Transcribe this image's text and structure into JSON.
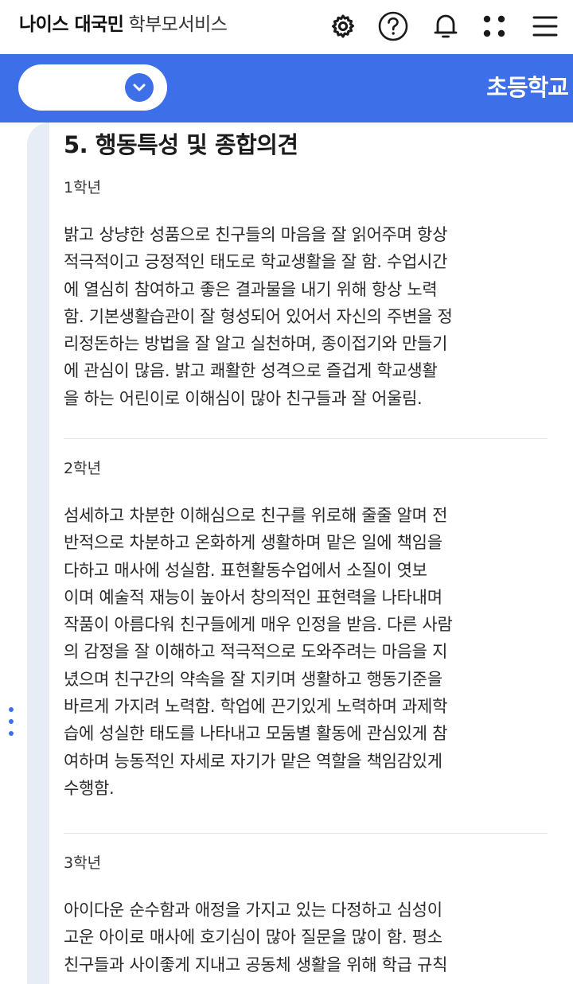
{
  "header": {
    "brand_bold": "나이스 대국민",
    "brand_light": "학부모서비스",
    "icons": [
      "gear-icon",
      "help-icon",
      "bell-icon",
      "apps-icon",
      "menu-icon"
    ]
  },
  "filter": {
    "selected_value": "",
    "school_label": "초등학교"
  },
  "colors": {
    "accent": "#3d6fe8",
    "gutter": "#e6edf5"
  },
  "section": {
    "title": "5. 행동특성 및 종합의견",
    "grades": [
      {
        "label": "1학년",
        "lines": [
          "밝고 상냥한 성품으로 친구들의 마음을 잘 읽어주며 항상",
          "적극적이고 긍정적인 태도로 학교생활을 잘 함. 수업시간",
          "에 열심히 참여하고 좋은 결과물을 내기 위해 항상 노력",
          "함. 기본생활습관이 잘 형성되어 있어서 자신의 주변을 정",
          "리정돈하는 방법을 잘 알고 실천하며, 종이접기와 만들기",
          "에 관심이 많음. 밝고 쾌활한 성격으로 즐겁게 학교생활",
          "을 하는 어린이로 이해심이 많아 친구들과 잘 어울림."
        ]
      },
      {
        "label": "2학년",
        "lines": [
          "섬세하고 차분한 이해심으로 친구를 위로해 줄줄 알며 전",
          "반적으로 차분하고 온화하게 생활하며 맡은 일에  책임을",
          "다하고  매사에  성실함.  표현활동수업에서 소질이 엿보",
          "이며 예술적 재능이 높아서 창의적인 표현력을 나타내며",
          "작품이 아름다워 친구들에게 매우 인정을 받음. 다른 사람",
          "의 감정을 잘 이해하고 적극적으로 도와주려는 마음을 지",
          "녔으며 친구간의 약속을 잘 지키며 생활하고 행동기준을",
          "바르게 가지려 노력함. 학업에 끈기있게 노력하며 과제학",
          "습에 성실한 태도를 나타내고 모둠별 활동에 관심있게  참",
          "여하며 능동적인 자세로 자기가 맡은 역할을 책임감있게",
          "수행함."
        ]
      },
      {
        "label": "3학년",
        "lines": [
          "아이다운 순수함과 애정을 가지고 있는 다정하고 심성이",
          "고운 아이로 매사에 호기심이 많아 질문을 많이 함. 평소",
          "친구들과 사이좋게 지내고 공동체 생활을 위해 학급 규칙"
        ]
      }
    ]
  }
}
